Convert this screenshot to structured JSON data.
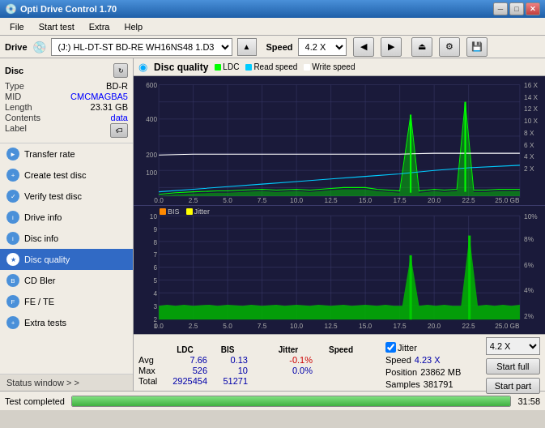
{
  "app": {
    "title": "Opti Drive Control 1.70",
    "icon": "💿"
  },
  "title_buttons": {
    "minimize": "─",
    "maximize": "□",
    "close": "✕"
  },
  "menu": {
    "items": [
      "File",
      "Start test",
      "Extra",
      "Help"
    ]
  },
  "drive_bar": {
    "drive_label": "Drive",
    "drive_value": "(J:)  HL-DT-ST BD-RE  WH16NS48 1.D3",
    "speed_label": "Speed",
    "speed_value": "4.2 X"
  },
  "disc": {
    "title": "Disc",
    "type_label": "Type",
    "type_value": "BD-R",
    "mid_label": "MID",
    "mid_value": "CMCMAGBA5",
    "length_label": "Length",
    "length_value": "23.31 GB",
    "contents_label": "Contents",
    "contents_value": "data",
    "label_label": "Label"
  },
  "nav": {
    "items": [
      {
        "id": "transfer-rate",
        "label": "Transfer rate",
        "active": false
      },
      {
        "id": "create-test-disc",
        "label": "Create test disc",
        "active": false
      },
      {
        "id": "verify-test-disc",
        "label": "Verify test disc",
        "active": false
      },
      {
        "id": "drive-info",
        "label": "Drive info",
        "active": false
      },
      {
        "id": "disc-info",
        "label": "Disc info",
        "active": false
      },
      {
        "id": "disc-quality",
        "label": "Disc quality",
        "active": true
      },
      {
        "id": "cd-bler",
        "label": "CD Bler",
        "active": false
      },
      {
        "id": "fe-te",
        "label": "FE / TE",
        "active": false
      },
      {
        "id": "extra-tests",
        "label": "Extra tests",
        "active": false
      }
    ]
  },
  "status_window": {
    "label": "Status window > >"
  },
  "chart": {
    "title": "Disc quality",
    "legend": [
      {
        "id": "ldc",
        "label": "LDC",
        "color": "#00ff00"
      },
      {
        "id": "read-speed",
        "label": "Read speed",
        "color": "#00ccff"
      },
      {
        "id": "write-speed",
        "label": "Write speed",
        "color": "#ffffff"
      }
    ],
    "legend2": [
      {
        "id": "bis",
        "label": "BIS",
        "color": "#ff8800"
      },
      {
        "id": "jitter",
        "label": "Jitter",
        "color": "#ffff00"
      }
    ],
    "upper": {
      "y_max": 600,
      "y_labels": [
        "600",
        "400",
        "200",
        "100"
      ],
      "x_labels": [
        "0.0",
        "2.5",
        "5.0",
        "7.5",
        "10.0",
        "12.5",
        "15.0",
        "17.5",
        "20.0",
        "22.5",
        "25.0 GB"
      ],
      "right_labels": [
        "16 X",
        "14 X",
        "12 X",
        "10 X",
        "8 X",
        "6 X",
        "4 X",
        "2 X"
      ]
    },
    "lower": {
      "y_max": 10,
      "y_labels": [
        "10",
        "9",
        "8",
        "7",
        "6",
        "5",
        "4",
        "3",
        "2",
        "1"
      ],
      "x_labels": [
        "0.0",
        "2.5",
        "5.0",
        "7.5",
        "10.0",
        "12.5",
        "15.0",
        "17.5",
        "20.0",
        "22.5",
        "25.0 GB"
      ],
      "right_labels": [
        "10%",
        "8%",
        "6%",
        "4%",
        "2%"
      ]
    }
  },
  "stats": {
    "headers": [
      "LDC",
      "BIS",
      "",
      "Jitter",
      "Speed",
      ""
    ],
    "avg_label": "Avg",
    "avg_ldc": "7.66",
    "avg_bis": "0.13",
    "avg_jitter": "-0.1%",
    "max_label": "Max",
    "max_ldc": "526",
    "max_bis": "10",
    "max_jitter": "0.0%",
    "total_label": "Total",
    "total_ldc": "2925454",
    "total_bis": "51271",
    "jitter_checked": true,
    "jitter_label": "Jitter",
    "speed_value": "4.23 X",
    "speed_label": "Speed",
    "speed2_value": "4.2 X",
    "position_label": "Position",
    "position_value": "23862 MB",
    "samples_label": "Samples",
    "samples_value": "381791",
    "start_full": "Start full",
    "start_part": "Start part"
  },
  "status_bar": {
    "status_text": "Test completed",
    "progress": 100,
    "time": "31:58"
  }
}
